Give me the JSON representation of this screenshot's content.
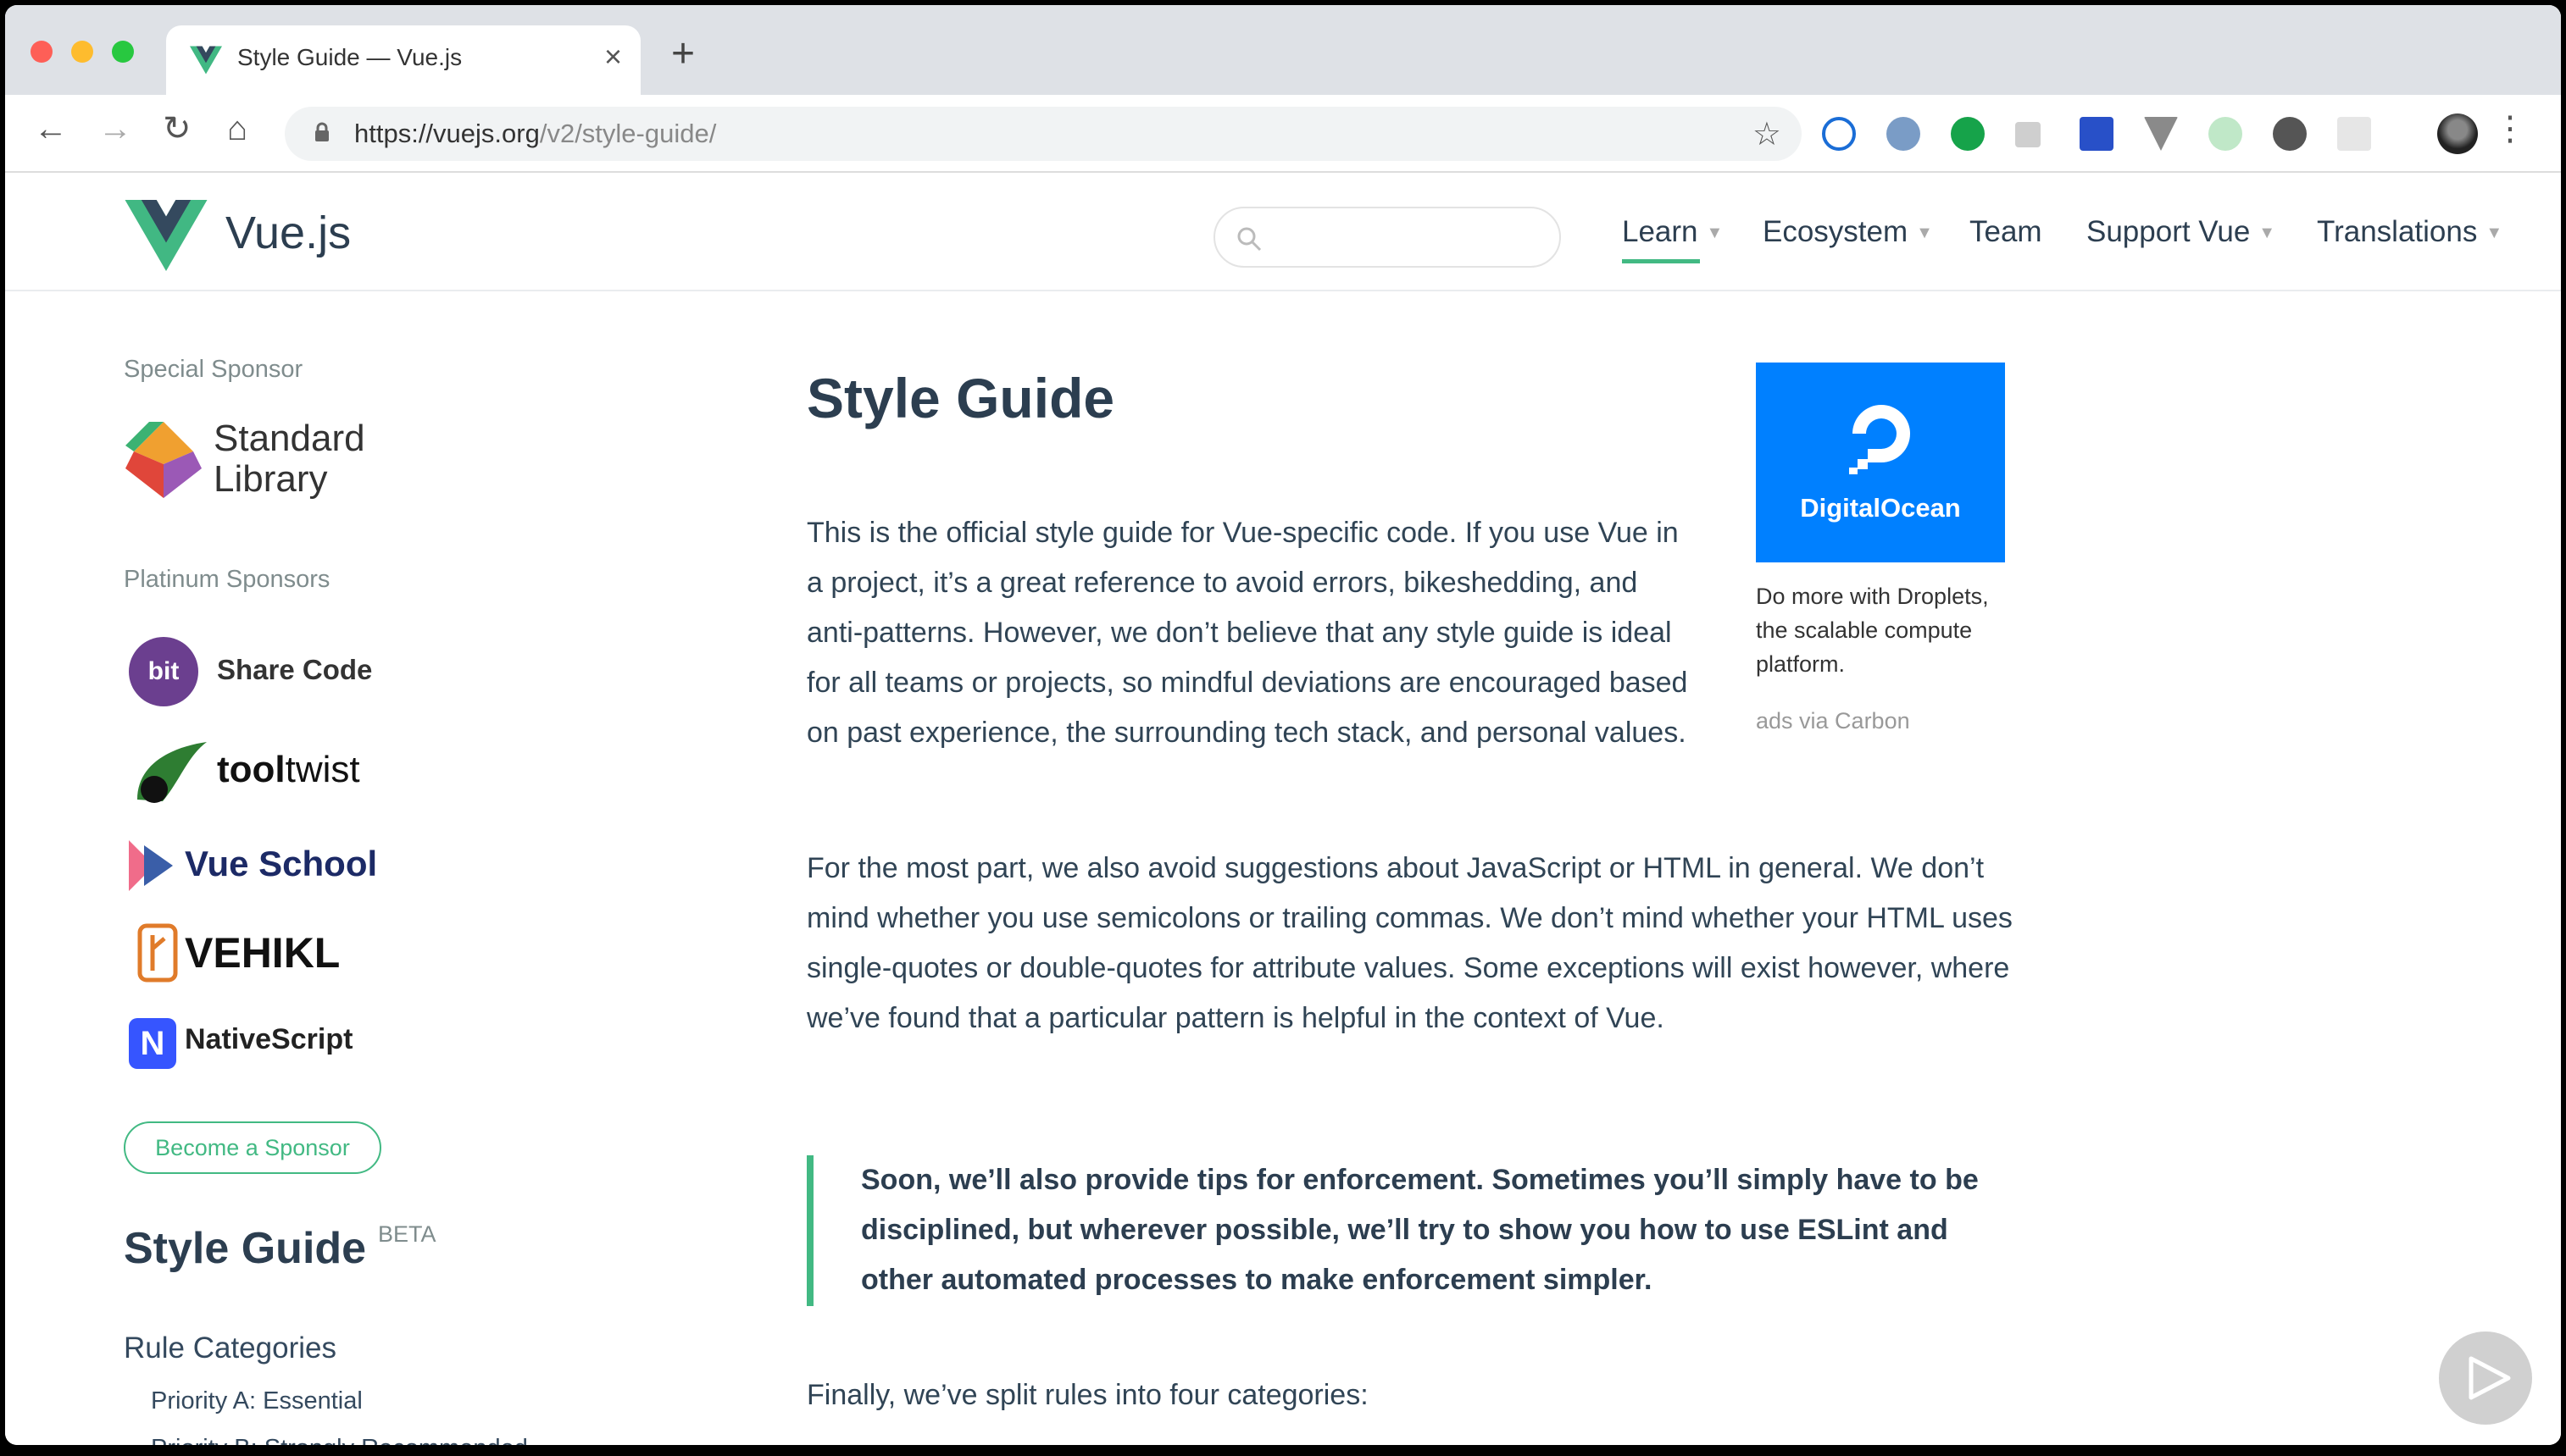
{
  "browser": {
    "tab_title": "Style Guide — Vue.js",
    "tab_close": "×",
    "new_tab": "+",
    "url_host": "https://vuejs.org",
    "url_path": "/v2/style-guide/",
    "back": "←",
    "forward": "→",
    "reload": "↻",
    "home": "⌂",
    "star": "☆",
    "menu": "⋮"
  },
  "header": {
    "site_name": "Vue.js",
    "nav": {
      "learn": "Learn",
      "ecosystem": "Ecosystem",
      "team": "Team",
      "support": "Support Vue",
      "translations": "Translations"
    },
    "caret": "▼"
  },
  "sidebar": {
    "special_sponsor_label": "Special Sponsor",
    "stdlib_name_1": "Standard",
    "stdlib_name_2": "Library",
    "platinum_label": "Platinum Sponsors",
    "bit_logo": "bit",
    "bit_text": "Share Code",
    "tooltwist_bold": "tool",
    "tooltwist_light": "twist",
    "vueschool": "Vue School",
    "vehikl": "VEHIKL",
    "nativescript": "NativeScript",
    "become_sponsor": "Become a Sponsor",
    "title": "Style Guide",
    "beta": "BETA",
    "rule_categories": "Rule Categories",
    "priority_a": "Priority A: Essential",
    "priority_b": "Priority B: Strongly Recommended"
  },
  "main": {
    "title": "Style Guide",
    "para1": "This is the official style guide for Vue-specific code. If you use Vue in a project, it’s a great reference to avoid errors, bikeshedding, and anti-patterns. However, we don’t believe that any style guide is ideal for all teams or projects, so mindful deviations are encouraged based on past experience, the surrounding tech stack, and personal values.",
    "para2": "For the most part, we also avoid suggestions about JavaScript or HTML in general. We don’t mind whether you use semicolons or trailing commas. We don’t mind whether your HTML uses single-quotes or double-quotes for attribute values. Some exceptions will exist however, where we’ve found that a particular pattern is helpful in the context of Vue.",
    "tip": "Soon, we’ll also provide tips for enforcement. Sometimes you’ll simply have to be disciplined, but wherever possible, we’ll try to show you how to use ESLint and other automated processes to make enforcement simpler.",
    "para3": "Finally, we’ve split rules into four categories:"
  },
  "carbon": {
    "brand": "DigitalOcean",
    "description": "Do more with Droplets, the scalable compute platform.",
    "via": "ads via Carbon"
  },
  "colors": {
    "accent": "#42b983",
    "text": "#2c3e50",
    "digitalocean": "#0080ff"
  },
  "icons": [
    "vue-favicon-icon",
    "lock-icon",
    "star-icon",
    "search-icon",
    "play-icon"
  ]
}
